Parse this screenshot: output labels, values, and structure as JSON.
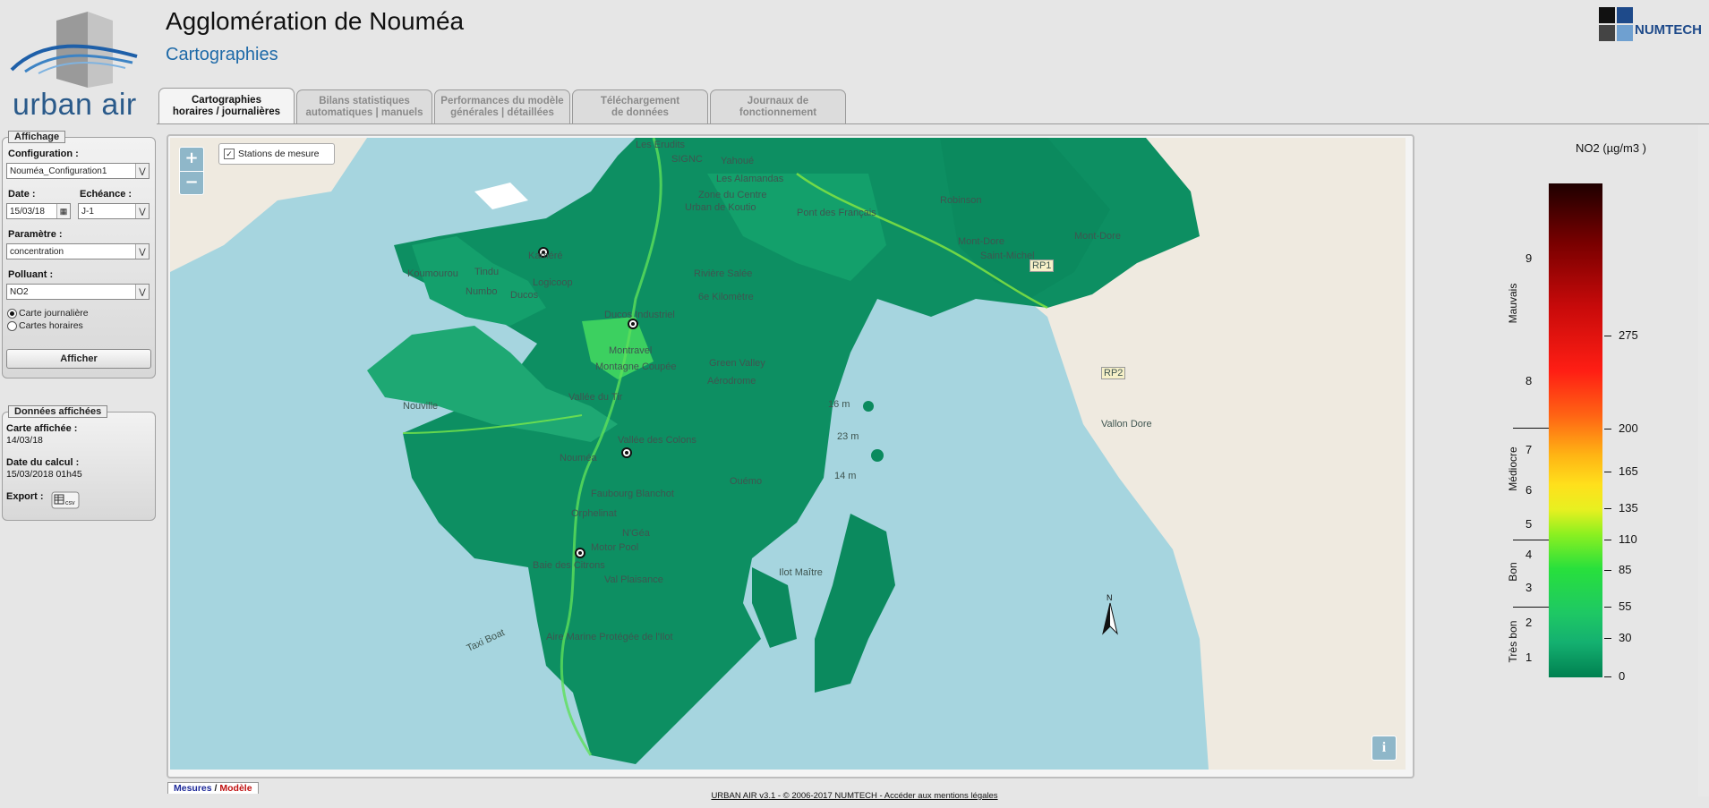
{
  "header": {
    "title": "Agglomération de Nouméa",
    "subtitle": "Cartographies",
    "logo_text": "urban air",
    "brand_logo_text": "NUMTECH"
  },
  "tabs": [
    {
      "label": "Cartographies\nhoraires / journalières",
      "active": true
    },
    {
      "label": "Bilans statistiques\nautomatiques | manuels",
      "active": false
    },
    {
      "label": "Performances du modèle\ngénérales | détaillées",
      "active": false
    },
    {
      "label": "Téléchargement\nde données",
      "active": false
    },
    {
      "label": "Journaux de\nfonctionnement",
      "active": false
    }
  ],
  "affichage": {
    "legend": "Affichage",
    "configuration_label": "Configuration :",
    "configuration_value": "Nouméa_Configuration1",
    "date_label": "Date :",
    "date_value": "15/03/18",
    "echeance_label": "Echéance :",
    "echeance_value": "J-1",
    "parametre_label": "Paramètre :",
    "parametre_value": "concentration",
    "polluant_label": "Polluant :",
    "polluant_value": "NO2",
    "radio_journaliere": "Carte journalière",
    "radio_horaires": "Cartes horaires",
    "selected_radio": "journaliere",
    "afficher_button": "Afficher"
  },
  "donnees": {
    "legend": "Données affichées",
    "carte_label": "Carte affichée :",
    "carte_value": "14/03/18",
    "calcul_label": "Date du calcul :",
    "calcul_value": "15/03/2018 01h45",
    "export_label": "Export :",
    "export_icon": "csv-icon"
  },
  "map": {
    "stations_label": "Stations de mesure",
    "stations_checked": true,
    "zoom_in": "+",
    "zoom_out": "−",
    "info": "i",
    "places": [
      "Les Erudits",
      "SIGNC",
      "Yahoué",
      "Les Alamandas",
      "Zone du Centre",
      "Urban de Koutio",
      "Robinson",
      "Pont des Français",
      "Mont-Dore",
      "Saint-Michel",
      "Koumourou",
      "Tindu",
      "Kaméré",
      "Logicoop",
      "Numbo",
      "Ducos",
      "Rivière Salée",
      "6e Kilomètre",
      "Ducos Industriel",
      "Montravel",
      "Montagne Coupée",
      "Green Valley",
      "Vallée du Tir",
      "Aérodrome",
      "Nouville",
      "Vallée des Colons",
      "Nouméa",
      "Faubourg Blanchot",
      "Orphelinat",
      "N'Géa",
      "Motor Pool",
      "Baie des Citrons",
      "Val Plaisance",
      "Ouémo",
      "Mont-Dore",
      "Vallon Dore",
      "Ilot Maître",
      "Taxi Boat",
      "Aire Marine Protégée de l'Ilot",
      "16 m",
      "23 m",
      "14 m",
      "RP1",
      "RP2"
    ],
    "north_symbol": "N"
  },
  "colorbar": {
    "title": "NO2 (µg/m3 )",
    "right_ticks": [
      "275",
      "200",
      "165",
      "135",
      "110",
      "85",
      "55",
      "30",
      "0"
    ],
    "left_ticks": [
      "9",
      "8",
      "7",
      "6",
      "5",
      "4",
      "3",
      "2",
      "1"
    ],
    "categories": [
      "Mauvais",
      "Médiocre",
      "Bon",
      "Très bon"
    ],
    "colors": {
      "low": "#008050",
      "mid": "#e8f020",
      "high": "#ff1e14",
      "max": "#1e0000"
    }
  },
  "bottom_tabs": {
    "mesures": "Mesures",
    "sep": " / ",
    "modele": "Modèle"
  },
  "footer": {
    "text": "URBAN AIR v3.1 - © 2006-2017 NUMTECH - Accéder aux mentions légales"
  }
}
